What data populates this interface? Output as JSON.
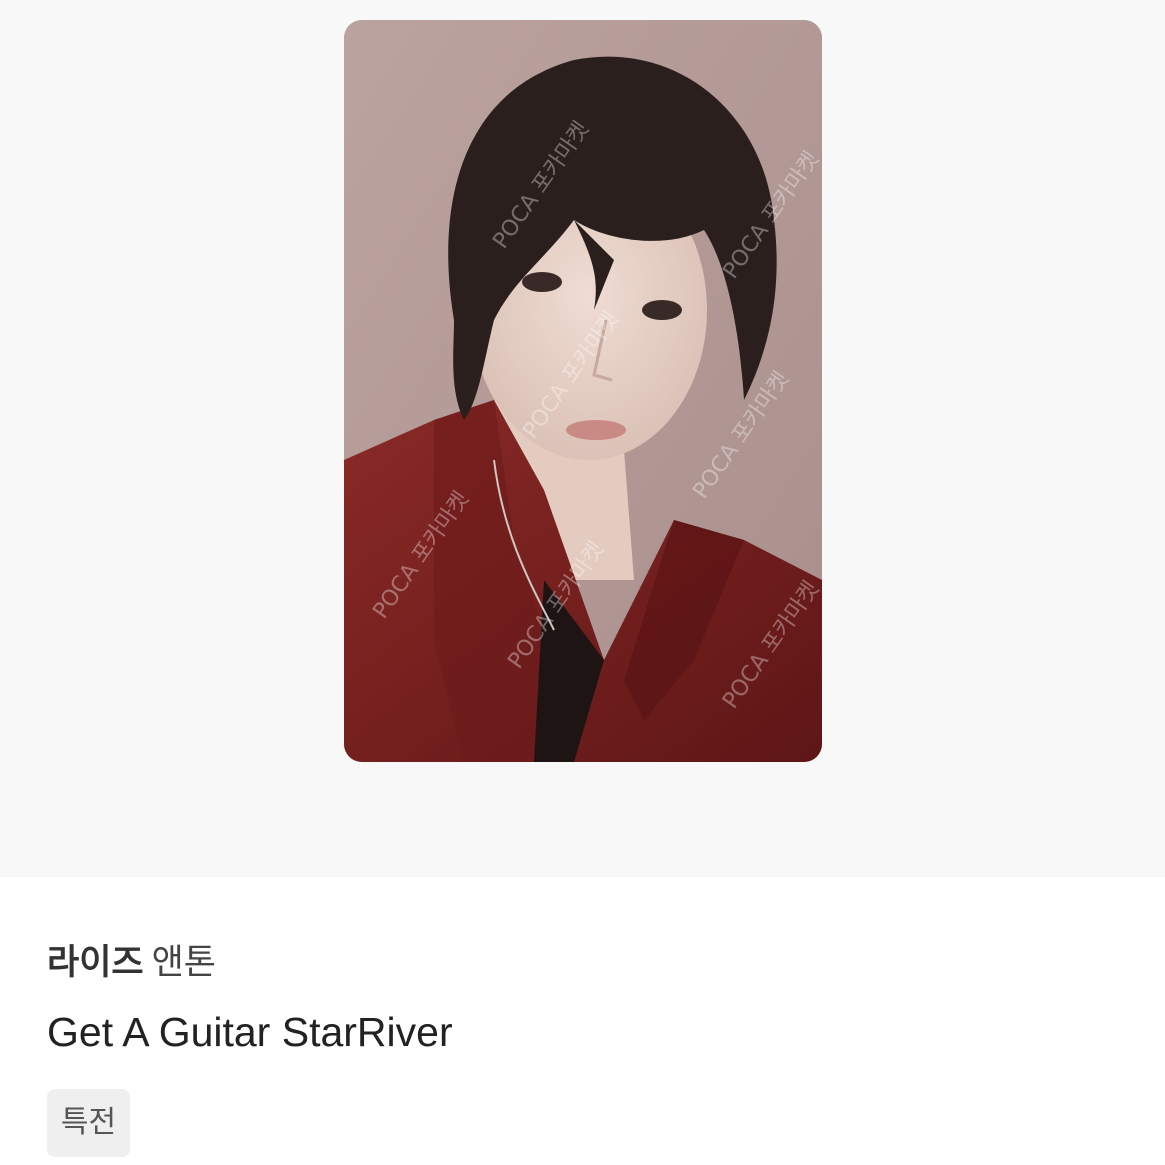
{
  "product": {
    "group": "라이즈",
    "member": "앤톤",
    "album": "Get A Guitar StarRiver",
    "tag": "특전"
  },
  "photocard": {
    "watermark": "POCA 포카마켓",
    "alt": "photocard"
  },
  "colors": {
    "photo_background": "#f8f8f8",
    "tag_background": "#efefef",
    "card_background": "#b79e9b",
    "shirt": "#7a1f1f"
  }
}
